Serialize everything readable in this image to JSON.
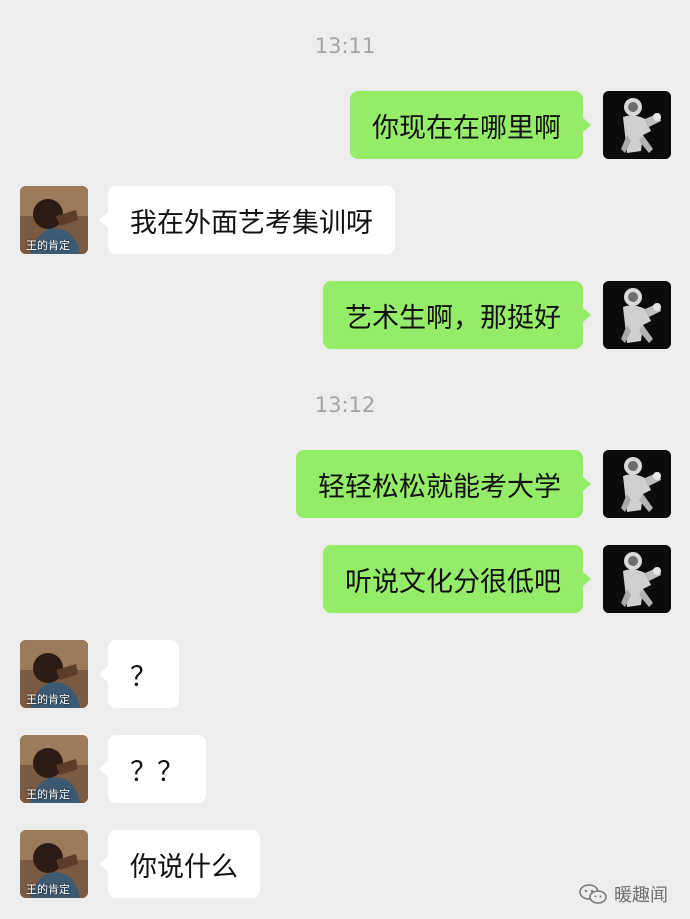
{
  "colors": {
    "background": "#ededed",
    "my_bubble": "#95ec69",
    "their_bubble": "#ffffff",
    "timestamp_text": "#a3a3a3"
  },
  "timestamps": [
    "13:11",
    "13:12"
  ],
  "contact": {
    "avatar_caption": "王的肯定"
  },
  "messages": [
    {
      "from": "me",
      "text": "你现在在哪里啊"
    },
    {
      "from": "them",
      "text": "我在外面艺考集训呀"
    },
    {
      "from": "me",
      "text": "艺术生啊，那挺好"
    },
    {
      "from": "me",
      "text": "轻轻松松就能考大学"
    },
    {
      "from": "me",
      "text": "听说文化分很低吧"
    },
    {
      "from": "them",
      "text": "？"
    },
    {
      "from": "them",
      "text": "？？"
    },
    {
      "from": "them",
      "text": "你说什么"
    }
  ],
  "watermark": {
    "icon": "wechat-channel-icon",
    "text": "暖趣闻"
  }
}
